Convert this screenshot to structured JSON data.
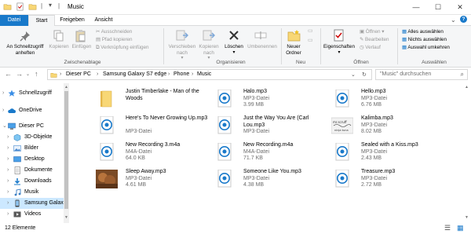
{
  "title": "Music",
  "tabs": [
    "Datei",
    "Start",
    "Freigeben",
    "Ansicht"
  ],
  "ribbon": {
    "pin": "An Schnellzugriff anheften",
    "copy": "Kopieren",
    "paste": "Einfügen",
    "cut": "Ausschneiden",
    "copy_path": "Pfad kopieren",
    "paste_shortcut": "Verknüpfung einfügen",
    "clipboard_group": "Zwischenablage",
    "move_to": "Verschieben nach",
    "copy_to": "Kopieren nach",
    "delete": "Löschen",
    "rename": "Umbenennen",
    "organize_group": "Organisieren",
    "new_folder": "Neuer Ordner",
    "new_group": "Neu",
    "properties": "Eigenschaften",
    "open": "Öffnen",
    "edit": "Bearbeiten",
    "history": "Verlauf",
    "open_group": "Öffnen",
    "select_all": "Alles auswählen",
    "select_none": "Nichts auswählen",
    "invert_selection": "Auswahl umkehren",
    "select_group": "Auswählen"
  },
  "breadcrumb": [
    "Dieser PC",
    "Samsung Galaxy S7 edge",
    "Phone",
    "Music"
  ],
  "search_placeholder": "\"Music\" durchsuchen",
  "sidebar": [
    {
      "label": "Schnellzugriff",
      "icon": "star-icon"
    },
    {
      "label": "OneDrive",
      "icon": "cloud-icon"
    },
    {
      "label": "Dieser PC",
      "icon": "computer-icon"
    },
    {
      "label": "3D-Objekte",
      "icon": "cube-icon"
    },
    {
      "label": "Bilder",
      "icon": "pictures-icon"
    },
    {
      "label": "Desktop",
      "icon": "desktop-icon"
    },
    {
      "label": "Dokumente",
      "icon": "documents-icon"
    },
    {
      "label": "Downloads",
      "icon": "downloads-icon"
    },
    {
      "label": "Musik",
      "icon": "music-icon"
    },
    {
      "label": "Samsung Galaxy",
      "icon": "phone-icon"
    },
    {
      "label": "Videos",
      "icon": "videos-icon"
    }
  ],
  "files": [
    {
      "name": "Justin Timberlake - Man of the Woods",
      "type": "",
      "size": "",
      "icon": "folder"
    },
    {
      "name": "Halo.mp3",
      "type": "MP3-Datei",
      "size": "3.99 MB",
      "icon": "audio"
    },
    {
      "name": "Hello.mp3",
      "type": "MP3-Datei",
      "size": "6.76 MB",
      "icon": "audio"
    },
    {
      "name": "Here's To Never Growing Up.mp3",
      "type": "MP3-Datei",
      "size": "",
      "icon": "audio"
    },
    {
      "name": "Just the Way You Are (Carl Lou.mp3",
      "type": "MP3-Datei",
      "size": "",
      "icon": "audio"
    },
    {
      "name": "Kalimba.mp3",
      "type": "MP3-Datei",
      "size": "8.02 MB",
      "icon": "kalimba"
    },
    {
      "name": "New Recording 3.m4a",
      "type": "M4A-Datei",
      "size": "64.0 KB",
      "icon": "audio"
    },
    {
      "name": "New Recording.m4a",
      "type": "M4A-Datei",
      "size": "71.7 KB",
      "icon": "audio"
    },
    {
      "name": "Sealed with a Kiss.mp3",
      "type": "MP3-Datei",
      "size": "2.43 MB",
      "icon": "audio"
    },
    {
      "name": "Sleep Away.mp3",
      "type": "MP3-Datei",
      "size": "4.61 MB",
      "icon": "sleepaway"
    },
    {
      "name": "Someone Like You.mp3",
      "type": "MP3-Datei",
      "size": "4.38 MB",
      "icon": "audio"
    },
    {
      "name": "Treasure.mp3",
      "type": "MP3-Datei",
      "size": "2.72 MB",
      "icon": "audio"
    }
  ],
  "status": "12 Elemente",
  "colors": {
    "accent": "#1979ca",
    "selected": "#cce8ff",
    "folder": "#f8d775"
  }
}
